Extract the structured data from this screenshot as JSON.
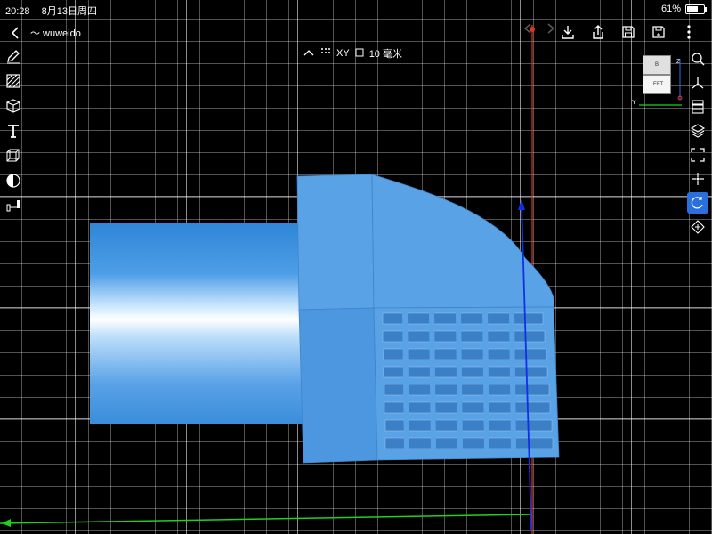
{
  "status": {
    "time": "20:28",
    "date": "8月13日周四",
    "battery": "61%"
  },
  "nav": {
    "path_label": "〜 wuweido"
  },
  "viewport_info": {
    "plane": "XY",
    "grid": "10 毫米"
  },
  "viewcube": {
    "top_label": "B",
    "front_label": "LEFT",
    "axis_z": "Z",
    "axis_y": "Y"
  },
  "colors": {
    "accent": "#2a6fde",
    "model": "#5aa2e6",
    "axis_x": "#e0322a",
    "axis_y": "#1fd21f",
    "axis_z": "#1030e8"
  },
  "left_tools": [
    {
      "name": "sketch-pencil-icon"
    },
    {
      "name": "hatch-icon"
    },
    {
      "name": "cube-icon"
    },
    {
      "name": "text-tool-icon"
    },
    {
      "name": "wireframe-cube-icon"
    },
    {
      "name": "material-sphere-icon"
    },
    {
      "name": "measure-icon"
    }
  ],
  "right_tools": [
    {
      "name": "zoom-search-icon"
    },
    {
      "name": "axes-icon"
    },
    {
      "name": "layers-stack-icon"
    },
    {
      "name": "layer-icon"
    },
    {
      "name": "fit-frame-icon"
    },
    {
      "name": "snap-point-icon"
    },
    {
      "name": "rotate-icon",
      "active": true
    },
    {
      "name": "transform-icon"
    }
  ],
  "top_actions": [
    {
      "name": "download-icon"
    },
    {
      "name": "share-icon"
    },
    {
      "name": "save-icon"
    },
    {
      "name": "save-as-icon"
    },
    {
      "name": "more-icon"
    }
  ]
}
